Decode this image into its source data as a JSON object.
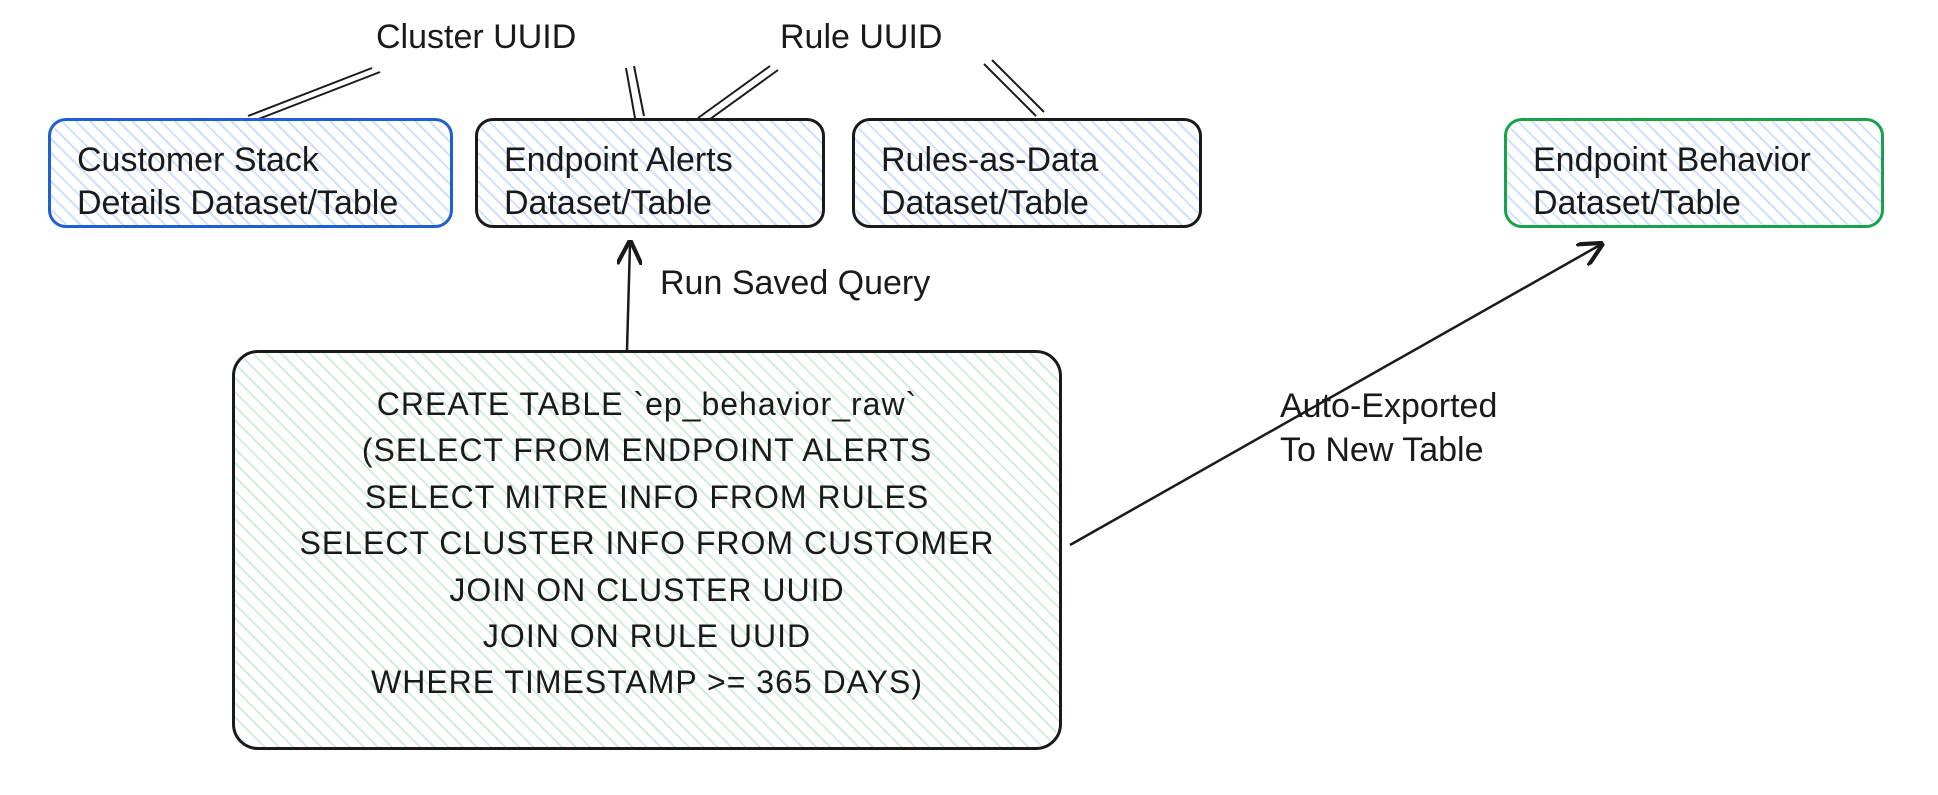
{
  "labels": {
    "cluster_uuid": "Cluster UUID",
    "rule_uuid": "Rule UUID",
    "run_saved_query": "Run Saved Query",
    "auto_exported": "Auto-Exported\nTo New Table"
  },
  "boxes": {
    "customer_stack": "Customer Stack\nDetails Dataset/Table",
    "endpoint_alerts": "Endpoint Alerts\nDataset/Table",
    "rules_as_data": "Rules-as-Data\nDataset/Table",
    "endpoint_behavior": "Endpoint Behavior\nDataset/Table"
  },
  "sql": {
    "l1": "CREATE TABLE `ep_behavior_raw`",
    "l2": "(SELECT FROM ENDPOINT ALERTS",
    "l3": "SELECT MITRE INFO FROM RULES",
    "l4": "SELECT CLUSTER INFO FROM CUSTOMER",
    "l5": "JOIN ON CLUSTER UUID",
    "l6": "JOIN ON RULE UUID",
    "l7": "WHERE TIMESTAMP >= 365 DAYS)"
  }
}
